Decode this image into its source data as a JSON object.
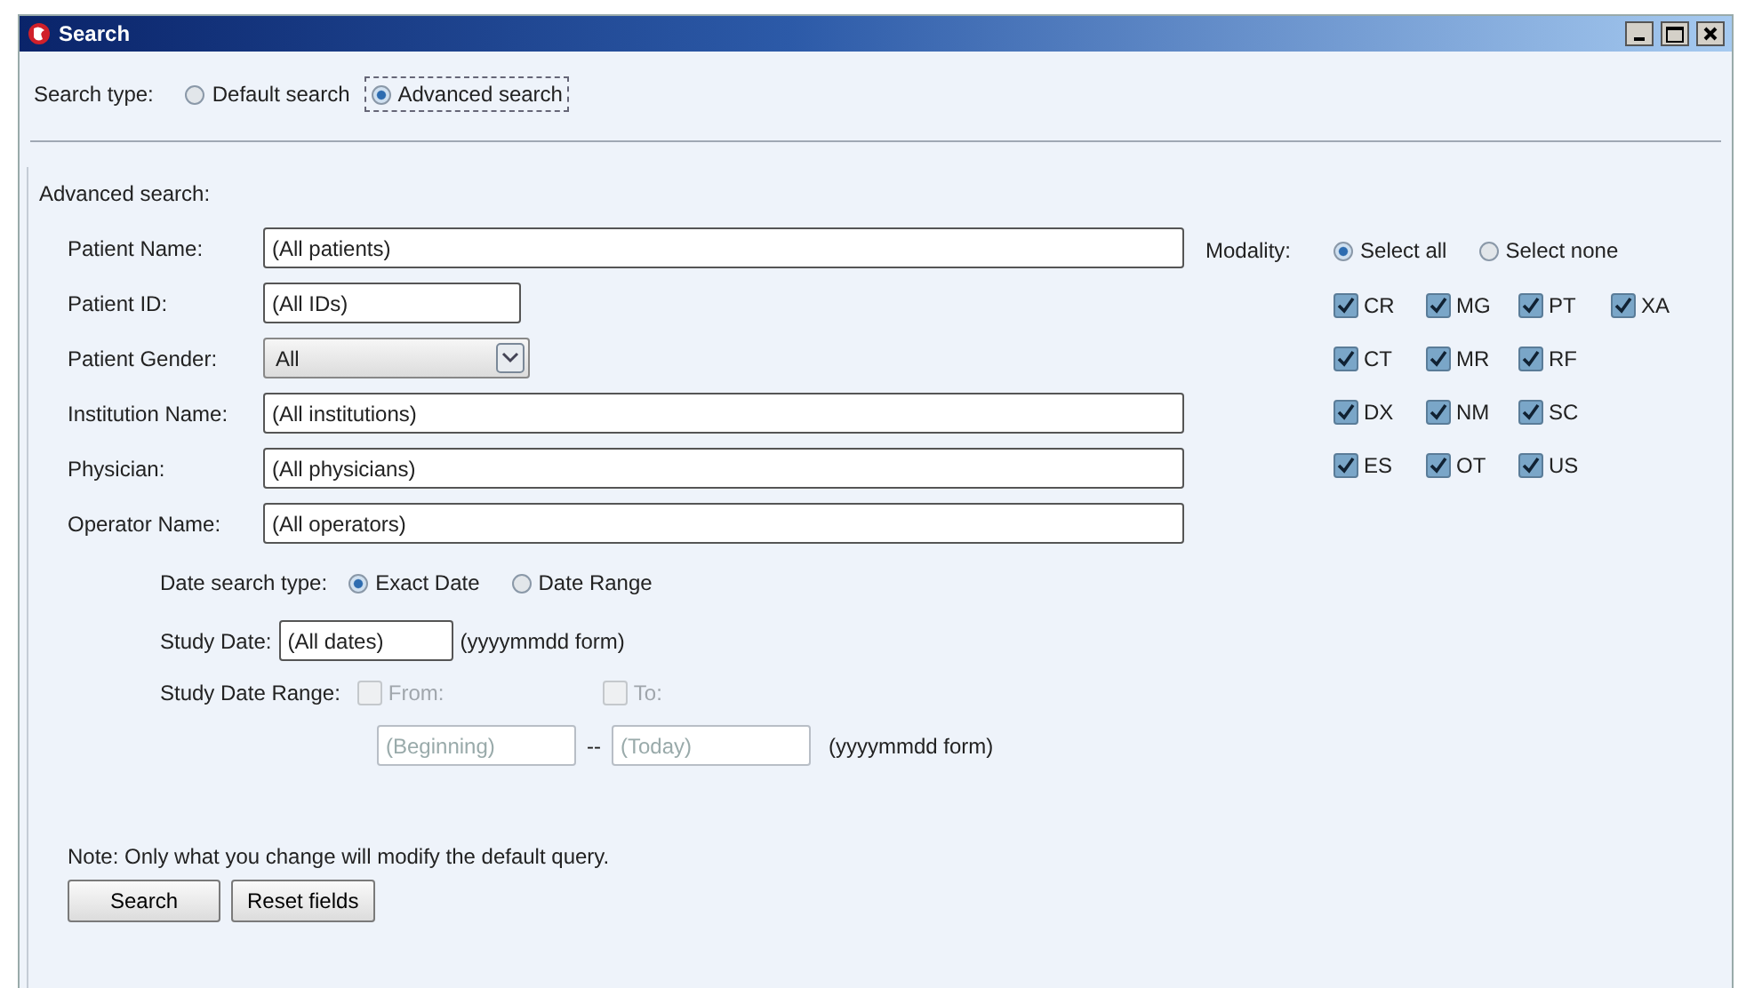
{
  "window": {
    "title": "Search"
  },
  "search_type": {
    "label": "Search type:",
    "options": [
      {
        "label": "Default search",
        "selected": false
      },
      {
        "label": "Advanced search",
        "selected": true
      }
    ]
  },
  "advanced": {
    "heading": "Advanced search:",
    "fields": [
      {
        "label": "Patient Name:",
        "value": "(All patients)",
        "kind": "text"
      },
      {
        "label": "Patient ID:",
        "value": "(All IDs)",
        "kind": "short"
      },
      {
        "label": "Patient Gender:",
        "value": "All",
        "kind": "select"
      },
      {
        "label": "Institution Name:",
        "value": "(All institutions)",
        "kind": "text"
      },
      {
        "label": "Physician:",
        "value": "(All physicians)",
        "kind": "text"
      },
      {
        "label": "Operator Name:",
        "value": "(All operators)",
        "kind": "text"
      }
    ],
    "modality": {
      "label": "Modality:",
      "options": [
        {
          "label": "Select all",
          "selected": true
        },
        {
          "label": "Select none",
          "selected": false
        }
      ],
      "rows": [
        [
          {
            "label": "CR",
            "checked": true
          },
          {
            "label": "MG",
            "checked": true
          },
          {
            "label": "PT",
            "checked": true
          },
          {
            "label": "XA",
            "checked": true
          }
        ],
        [
          {
            "label": "CT",
            "checked": true
          },
          {
            "label": "MR",
            "checked": true
          },
          {
            "label": "RF",
            "checked": true
          }
        ],
        [
          {
            "label": "DX",
            "checked": true
          },
          {
            "label": "NM",
            "checked": true
          },
          {
            "label": "SC",
            "checked": true
          }
        ],
        [
          {
            "label": "ES",
            "checked": true
          },
          {
            "label": "OT",
            "checked": true
          },
          {
            "label": "US",
            "checked": true
          }
        ]
      ]
    },
    "date_search_type": {
      "label": "Date search type:",
      "options": [
        {
          "label": "Exact Date",
          "selected": true
        },
        {
          "label": "Date Range",
          "selected": false
        }
      ]
    },
    "study_date": {
      "label": "Study Date:",
      "value": "(All dates)",
      "hint": "(yyyymmdd form)"
    },
    "date_range": {
      "label": "Study Date Range:",
      "disabled": true,
      "checks": [
        {
          "label": "From:",
          "checked": false
        },
        {
          "label": "To:",
          "checked": false
        }
      ],
      "from": "(Beginning)",
      "separator": "--",
      "to": "(Today)",
      "hint": "(yyyymmdd form)"
    },
    "note": "Note: Only what you change will modify the default query.",
    "buttons": [
      "Search",
      "Reset fields"
    ]
  }
}
